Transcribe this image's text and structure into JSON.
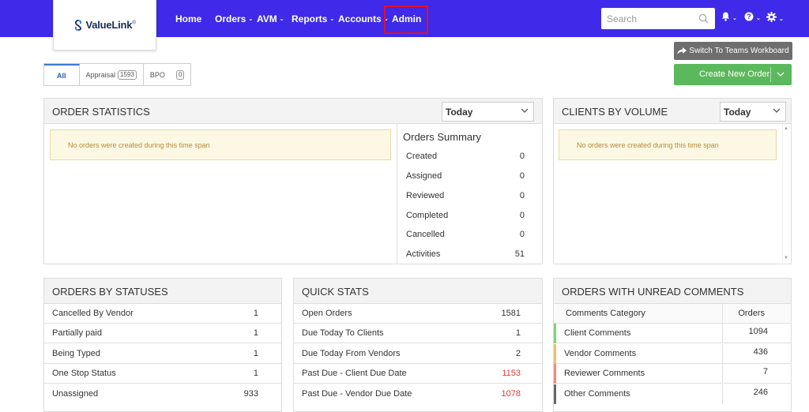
{
  "logo": {
    "text": "ValueLink",
    "mark": "®"
  },
  "nav": {
    "home": "Home",
    "orders": "Orders",
    "avm": "AVM",
    "reports": "Reports",
    "accounts": "Accounts",
    "admin": "Admin"
  },
  "search": {
    "placeholder": "Search"
  },
  "icons": {
    "bell": "bell-icon",
    "help": "question-circle-icon",
    "settings": "gear-icon"
  },
  "actions": {
    "switch_teams": "Switch To Teams Workboard",
    "create_order": "Create New Order"
  },
  "filter_tabs": [
    {
      "label": "All"
    },
    {
      "label": "Appraisal",
      "count": "1593"
    },
    {
      "label": "BPO",
      "count": "0"
    }
  ],
  "order_statistics": {
    "title": "ORDER STATISTICS",
    "period": "Today",
    "notice": "No orders were created during this time span",
    "summary_title": "Orders Summary",
    "summary": [
      {
        "label": "Created",
        "value": "0"
      },
      {
        "label": "Assigned",
        "value": "0"
      },
      {
        "label": "Reviewed",
        "value": "0"
      },
      {
        "label": "Completed",
        "value": "0"
      },
      {
        "label": "Cancelled",
        "value": "0"
      },
      {
        "label": "Activities",
        "value": "51"
      }
    ]
  },
  "clients_by_volume": {
    "title": "CLIENTS BY VOLUME",
    "period": "Today",
    "notice": "No orders were created during this time span"
  },
  "orders_by_statuses": {
    "title": "ORDERS BY STATUSES",
    "rows": [
      {
        "label": "Cancelled By Vendor",
        "value": "1"
      },
      {
        "label": "Partially paid",
        "value": "1"
      },
      {
        "label": "Being Typed",
        "value": "1"
      },
      {
        "label": "One Stop Status",
        "value": "1"
      },
      {
        "label": "Unassigned",
        "value": "933"
      }
    ]
  },
  "quick_stats": {
    "title": "QUICK STATS",
    "rows": [
      {
        "label": "Open Orders",
        "value": "1581"
      },
      {
        "label": "Due Today To Clients",
        "value": "1"
      },
      {
        "label": "Due Today From Vendors",
        "value": "2"
      },
      {
        "label": "Past Due - Client Due Date",
        "value": "1153"
      },
      {
        "label": "Past Due - Vendor Due Date",
        "value": "1078"
      }
    ]
  },
  "unread_comments": {
    "title": "ORDERS WITH UNREAD COMMENTS",
    "col_category": "Comments Category",
    "col_orders": "Orders",
    "rows": [
      {
        "label": "Client Comments",
        "value": "1094",
        "color": "#7ed37e"
      },
      {
        "label": "Vendor Comments",
        "value": "436",
        "color": "#f0c070"
      },
      {
        "label": "Reviewer Comments",
        "value": "7",
        "color": "#f08a8a"
      },
      {
        "label": "Other Comments",
        "value": "246",
        "color": "#666666"
      }
    ]
  },
  "colors": {
    "nav_bg": "#3e2ae8",
    "create_btn": "#5cb85c",
    "alert_value": "#e53935"
  }
}
